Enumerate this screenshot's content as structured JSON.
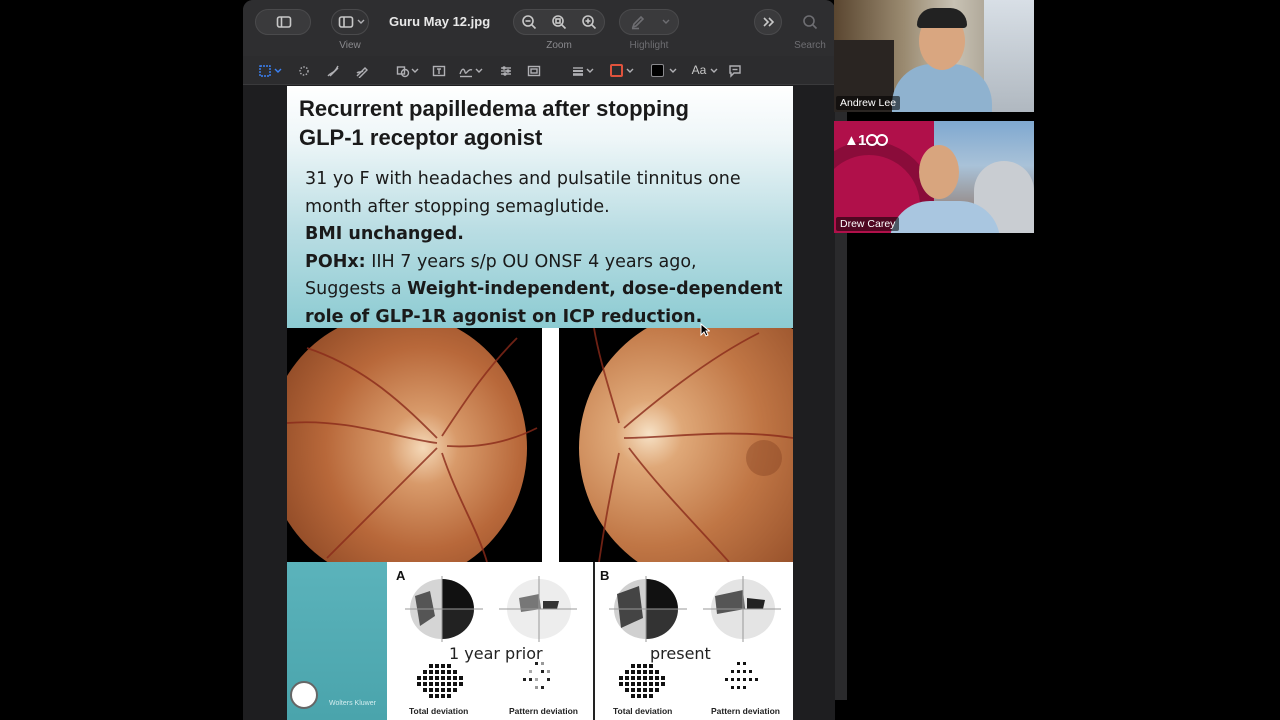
{
  "window": {
    "title": "Guru May 12.jpg",
    "toolbar": {
      "view_label": "View",
      "zoom_label": "Zoom",
      "highlight_label": "Highlight",
      "search_label": "Search",
      "font_label": "Aa"
    }
  },
  "slide": {
    "title_line1": "Recurrent papilledema after stopping",
    "title_line2": "GLP-1 receptor agonist",
    "body_line1": "31 yo F with headaches and pulsatile tinnitus one",
    "body_line2": "month after stopping semaglutide.",
    "body_line3_bold": "BMI unchanged.",
    "body_line4_bold": "POHx:",
    "body_line4_rest": " IIH 7 years s/p OU ONSF 4 years ago,",
    "body_line5_pre": "Suggests a ",
    "body_line5_bold": "Weight-independent, dose-dependent",
    "body_line6_bold": "role of GLP-1R agonist on ICP reduction.",
    "vf": {
      "panel_a_letter": "A",
      "panel_b_letter": "B",
      "panel_a_caption": "1 year prior",
      "panel_b_caption": "present",
      "total_deviation": "Total deviation",
      "pattern_deviation": "Pattern deviation",
      "publisher": "Wolters Kluwer"
    }
  },
  "participants": [
    {
      "name": "Andrew Lee"
    },
    {
      "name": "Drew Carey"
    }
  ]
}
